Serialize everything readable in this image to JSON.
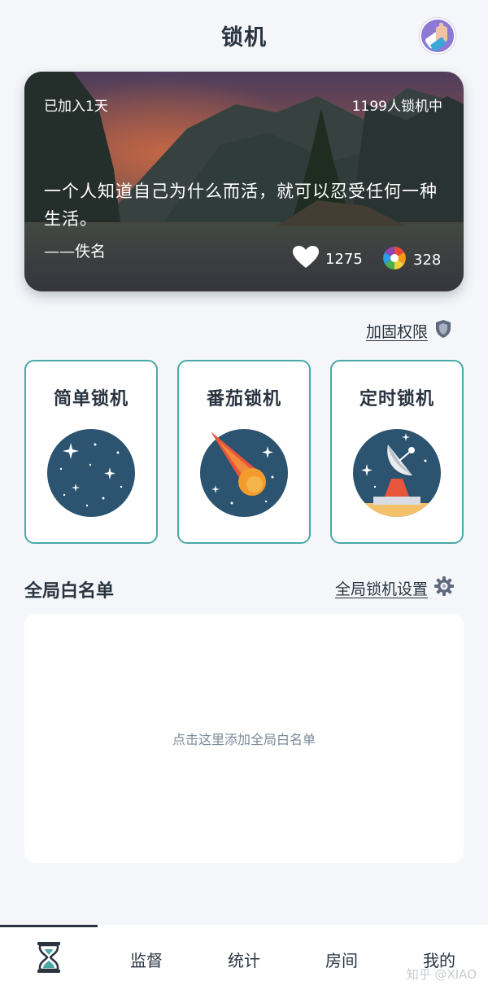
{
  "header": {
    "title": "锁机"
  },
  "hero": {
    "joined": "已加入1天",
    "online_count": "1199人锁机中",
    "quote": "一个人知道自己为什么而活，就可以忍受任何一种生活。",
    "author": "——佚名",
    "likes": "1275",
    "photos": "328"
  },
  "reinforce": {
    "label": "加固权限",
    "icon": "shield-icon"
  },
  "modes": [
    {
      "title": "简单锁机",
      "icon": "night-sky-icon"
    },
    {
      "title": "番茄锁机",
      "icon": "comet-icon"
    },
    {
      "title": "定时锁机",
      "icon": "satellite-dish-icon"
    }
  ],
  "whitelist": {
    "title": "全局白名单",
    "settings_label": "全局锁机设置",
    "hint": "点击这里添加全局白名单"
  },
  "tabs": [
    {
      "label": "",
      "icon": "hourglass-icon"
    },
    {
      "label": "监督"
    },
    {
      "label": "统计"
    },
    {
      "label": "房间"
    },
    {
      "label": "我的"
    }
  ],
  "watermark": "知乎 @XIAO",
  "colors": {
    "accent": "#4aa8a7",
    "dark_navy": "#2a3440",
    "planet": "#2c5470"
  }
}
